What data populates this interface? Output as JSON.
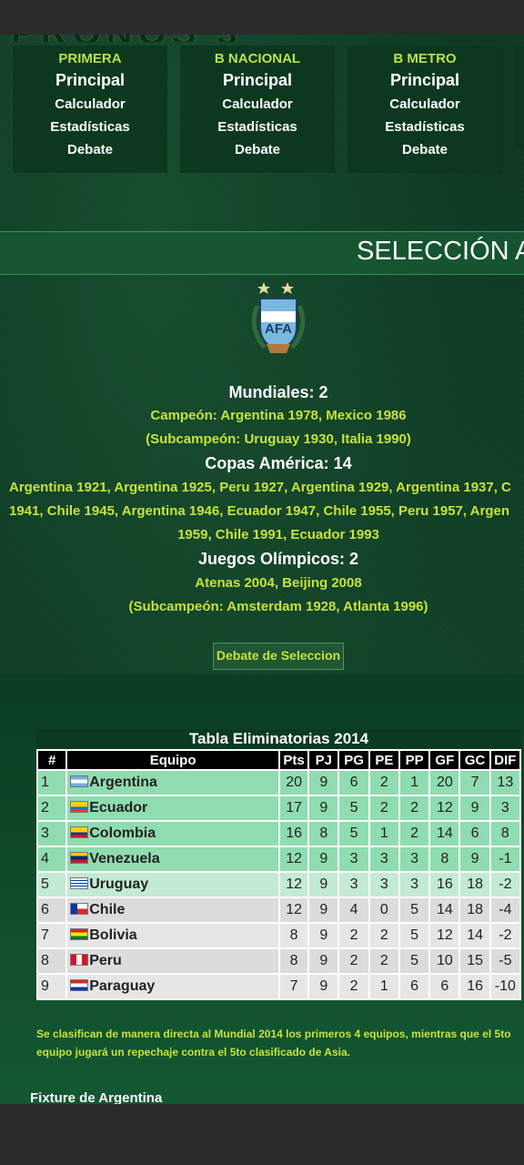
{
  "menu": [
    {
      "head": "PRIMERA",
      "main": "Principal",
      "links": [
        "Calculador",
        "Estadísticas",
        "Debate"
      ]
    },
    {
      "head": "B NACIONAL",
      "main": "Principal",
      "links": [
        "Calculador",
        "Estadísticas",
        "Debate"
      ]
    },
    {
      "head": "B METRO",
      "main": "Principal",
      "links": [
        "Calculador",
        "Estadísticas",
        "Debate"
      ]
    }
  ],
  "banner": {
    "title": "SELECCIÓN A"
  },
  "crest": {
    "letters": "AFA",
    "stars": 2
  },
  "honours": {
    "mundiales_title": "Mundiales: 2",
    "mundiales_campeon": "Campeón: Argentina 1978, Mexico 1986",
    "mundiales_sub": "(Subcampeón: Uruguay 1930, Italia 1990)",
    "copas_title": "Copas América: 14",
    "copas_line1": "Argentina 1921, Argentina 1925, Peru 1927, Argentina 1929, Argentina 1937, C",
    "copas_line2": "1941, Chile 1945, Argentina 1946, Ecuador 1947, Chile 1955, Peru 1957, Argen",
    "copas_line3": "1959, Chile 1991, Ecuador 1993",
    "jjoo_title": "Juegos Olímpicos: 2",
    "jjoo_campeon": "Atenas 2004, Beijing 2008",
    "jjoo_sub": "(Subcampeón: Amsterdam 1928, Atlanta 1996)"
  },
  "debate_button": "Debate de Seleccion",
  "table": {
    "title": "Tabla Eliminatorias 2014",
    "headers": [
      "#",
      "Equipo",
      "Pts",
      "PJ",
      "PG",
      "PE",
      "PP",
      "GF",
      "GC",
      "DIF"
    ],
    "rows": [
      {
        "pos": "1",
        "team": "Argentina",
        "flag": "argentina",
        "pts": "20",
        "pj": "9",
        "pg": "6",
        "pe": "2",
        "pp": "1",
        "gf": "20",
        "gc": "7",
        "dif": "13",
        "status": "q"
      },
      {
        "pos": "2",
        "team": "Ecuador",
        "flag": "ecuador",
        "pts": "17",
        "pj": "9",
        "pg": "5",
        "pe": "2",
        "pp": "2",
        "gf": "12",
        "gc": "9",
        "dif": "3",
        "status": "q"
      },
      {
        "pos": "3",
        "team": "Colombia",
        "flag": "colombia",
        "pts": "16",
        "pj": "8",
        "pg": "5",
        "pe": "1",
        "pp": "2",
        "gf": "14",
        "gc": "6",
        "dif": "8",
        "status": "q"
      },
      {
        "pos": "4",
        "team": "Venezuela",
        "flag": "venezuela",
        "pts": "12",
        "pj": "9",
        "pg": "3",
        "pe": "3",
        "pp": "3",
        "gf": "8",
        "gc": "9",
        "dif": "-1",
        "status": "q"
      },
      {
        "pos": "5",
        "team": "Uruguay",
        "flag": "uruguay",
        "pts": "12",
        "pj": "9",
        "pg": "3",
        "pe": "3",
        "pp": "3",
        "gf": "16",
        "gc": "18",
        "dif": "-2",
        "status": "r"
      },
      {
        "pos": "6",
        "team": "Chile",
        "flag": "chile",
        "pts": "12",
        "pj": "9",
        "pg": "4",
        "pe": "0",
        "pp": "5",
        "gf": "14",
        "gc": "18",
        "dif": "-4",
        "status": "o"
      },
      {
        "pos": "7",
        "team": "Bolivia",
        "flag": "bolivia",
        "pts": "8",
        "pj": "9",
        "pg": "2",
        "pe": "2",
        "pp": "5",
        "gf": "12",
        "gc": "14",
        "dif": "-2",
        "status": "w"
      },
      {
        "pos": "8",
        "team": "Peru",
        "flag": "peru",
        "pts": "8",
        "pj": "9",
        "pg": "2",
        "pe": "2",
        "pp": "5",
        "gf": "10",
        "gc": "15",
        "dif": "-5",
        "status": "o"
      },
      {
        "pos": "9",
        "team": "Paraguay",
        "flag": "paraguay",
        "pts": "7",
        "pj": "9",
        "pg": "2",
        "pe": "1",
        "pp": "6",
        "gf": "6",
        "gc": "16",
        "dif": "-10",
        "status": "w"
      }
    ]
  },
  "note": "Se clasifican de manera directa al Mundial 2014 los primeros 4 equipos, mientras que el 5to equipo jugará un repechaje contra el 5to clasificado de Asia.",
  "fixture_heading": "Fixture de Argentina",
  "colors": {
    "accent": "#c7e23a",
    "background": "#0d3a22",
    "qualified": "#8fdcb0",
    "playoff": "#c3ead3"
  }
}
